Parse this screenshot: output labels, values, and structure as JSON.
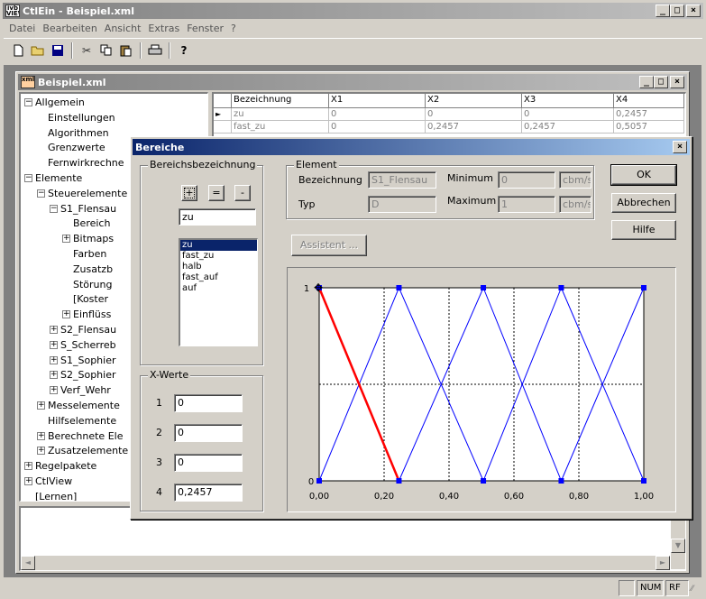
{
  "app": {
    "title": "CtlEin - Beispiel.xml"
  },
  "menu": [
    "Datei",
    "Bearbeiten",
    "Ansicht",
    "Extras",
    "Fenster",
    "?"
  ],
  "toolbar_icons": [
    "new-file-icon",
    "open-folder-icon",
    "save-icon",
    "cut-icon",
    "copy-icon",
    "paste-icon",
    "print-icon",
    "help-icon"
  ],
  "doc": {
    "title": "Beispiel.xml"
  },
  "tree": [
    {
      "label": "Allgemein",
      "exp": "minus"
    },
    {
      "label": "Einstellungen"
    },
    {
      "label": "Algorithmen"
    },
    {
      "label": "Grenzwerte"
    },
    {
      "label": "Fernwirkrechne"
    },
    {
      "label": "Elemente",
      "exp": "minus"
    },
    {
      "label": "Steuerelemente",
      "exp": "minus"
    },
    {
      "label": "S1_Flensau",
      "exp": "minus"
    },
    {
      "label": "Bereich"
    },
    {
      "label": "Bitmaps",
      "exp": "plus"
    },
    {
      "label": "Farben"
    },
    {
      "label": "Zusatzb"
    },
    {
      "label": "Störung"
    },
    {
      "label": "[Koster"
    },
    {
      "label": "Einflüss",
      "exp": "plus"
    },
    {
      "label": "S2_Flensau",
      "exp": "plus"
    },
    {
      "label": "S_Scherreb",
      "exp": "plus"
    },
    {
      "label": "S1_Sophier",
      "exp": "plus"
    },
    {
      "label": "S2_Sophier",
      "exp": "plus"
    },
    {
      "label": "Verf_Wehr",
      "exp": "plus"
    },
    {
      "label": "Messelemente",
      "exp": "plus"
    },
    {
      "label": "Hilfselemente"
    },
    {
      "label": "Berechnete Ele",
      "exp": "plus"
    },
    {
      "label": "Zusatzelemente",
      "exp": "plus"
    },
    {
      "label": "Regelpakete",
      "exp": "plus"
    },
    {
      "label": "CtlView",
      "exp": "plus"
    },
    {
      "label": "[Lernen]"
    }
  ],
  "grid": {
    "headers": [
      "Bezeichnung",
      "X1",
      "X2",
      "X3",
      "X4"
    ],
    "rows": [
      [
        "zu",
        "0",
        "0",
        "0",
        "0,2457"
      ],
      [
        "fast_zu",
        "0",
        "0,2457",
        "0,2457",
        "0,5057"
      ]
    ]
  },
  "dialog": {
    "title": "Bereiche",
    "group_bereich": "Bereichsbezeichnung",
    "btn_add": "+",
    "btn_eq": "=",
    "btn_minus": "-",
    "name_value": "zu",
    "list": [
      "zu",
      "fast_zu",
      "halb",
      "fast_auf",
      "auf"
    ],
    "selected_index": 0,
    "group_element": "Element",
    "lbl_bezeichnung": "Bezeichnung",
    "bezeichnung": "S1_Flensau",
    "lbl_typ": "Typ",
    "typ": "D",
    "lbl_minimum": "Minimum",
    "minimum": "0",
    "lbl_maximum": "Maximum",
    "maximum": "1",
    "unit_min": "cbm/s",
    "unit_max": "cbm/s",
    "btn_ok": "OK",
    "btn_cancel": "Abbrechen",
    "btn_help": "Hilfe",
    "btn_assistent": "Assistent ...",
    "group_xwerte": "X-Werte",
    "xwerte": [
      {
        "n": "1",
        "v": "0"
      },
      {
        "n": "2",
        "v": "0"
      },
      {
        "n": "3",
        "v": "0"
      },
      {
        "n": "4",
        "v": "0,2457"
      }
    ]
  },
  "chart_data": {
    "type": "line",
    "xlim": [
      0,
      1
    ],
    "ylim": [
      0,
      1
    ],
    "xticks": [
      "0,00",
      "0,20",
      "0,40",
      "0,60",
      "0,80",
      "1,00"
    ],
    "yticks": [
      "0",
      "1"
    ],
    "colors": {
      "selected": "#ff0000",
      "other": "#0000ff",
      "marker": "#0000ff"
    },
    "series": [
      {
        "points": [
          [
            0,
            1
          ],
          [
            0,
            1
          ],
          [
            0,
            1
          ],
          [
            0.2457,
            0
          ]
        ],
        "selected": true
      },
      {
        "points": [
          [
            0,
            0
          ],
          [
            0.2457,
            1
          ],
          [
            0.2457,
            1
          ],
          [
            0.5057,
            0
          ]
        ]
      },
      {
        "points": [
          [
            0.2457,
            0
          ],
          [
            0.5057,
            1
          ],
          [
            0.5057,
            1
          ],
          [
            0.7457,
            0
          ]
        ]
      },
      {
        "points": [
          [
            0.5057,
            0
          ],
          [
            0.7457,
            1
          ],
          [
            0.7457,
            1
          ],
          [
            1,
            0
          ]
        ]
      },
      {
        "points": [
          [
            0.7457,
            0
          ],
          [
            1,
            1
          ],
          [
            1,
            1
          ],
          [
            1,
            1
          ]
        ]
      }
    ]
  },
  "status": {
    "num": "NUM",
    "rf": "RF"
  }
}
